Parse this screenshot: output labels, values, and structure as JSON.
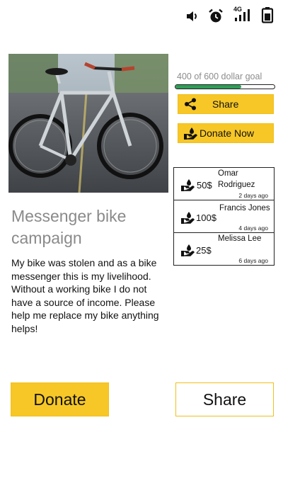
{
  "status_bar": {
    "icons": [
      "volume-icon",
      "alarm-icon",
      "signal-icon",
      "battery-icon"
    ],
    "network_label": "4G"
  },
  "campaign": {
    "photo_alt": "bicycle-photo",
    "title": "Messenger bike campaign",
    "description": "My bike was stolen and as a bike messenger this is my livelihood. Without a working bike I do not have a source of income. Please help me replace my bike anything helps!"
  },
  "goal": {
    "text": "400 of 600 dollar goal",
    "raised": 400,
    "target": 600,
    "bar_color": "#2e9e57"
  },
  "actions": {
    "share_label": "Share",
    "donate_now_label": "Donate Now",
    "donate_label": "Donate",
    "share_bottom_label": "Share",
    "accent_color": "#f7c727"
  },
  "donors": [
    {
      "amount": "50$",
      "name": "Omar Rodriguez",
      "time": "2 days ago"
    },
    {
      "amount": "100$",
      "name": "Francis Jones",
      "time": "4 days ago"
    },
    {
      "amount": "25$",
      "name": "Melissa Lee",
      "time": "6 days ago"
    }
  ]
}
